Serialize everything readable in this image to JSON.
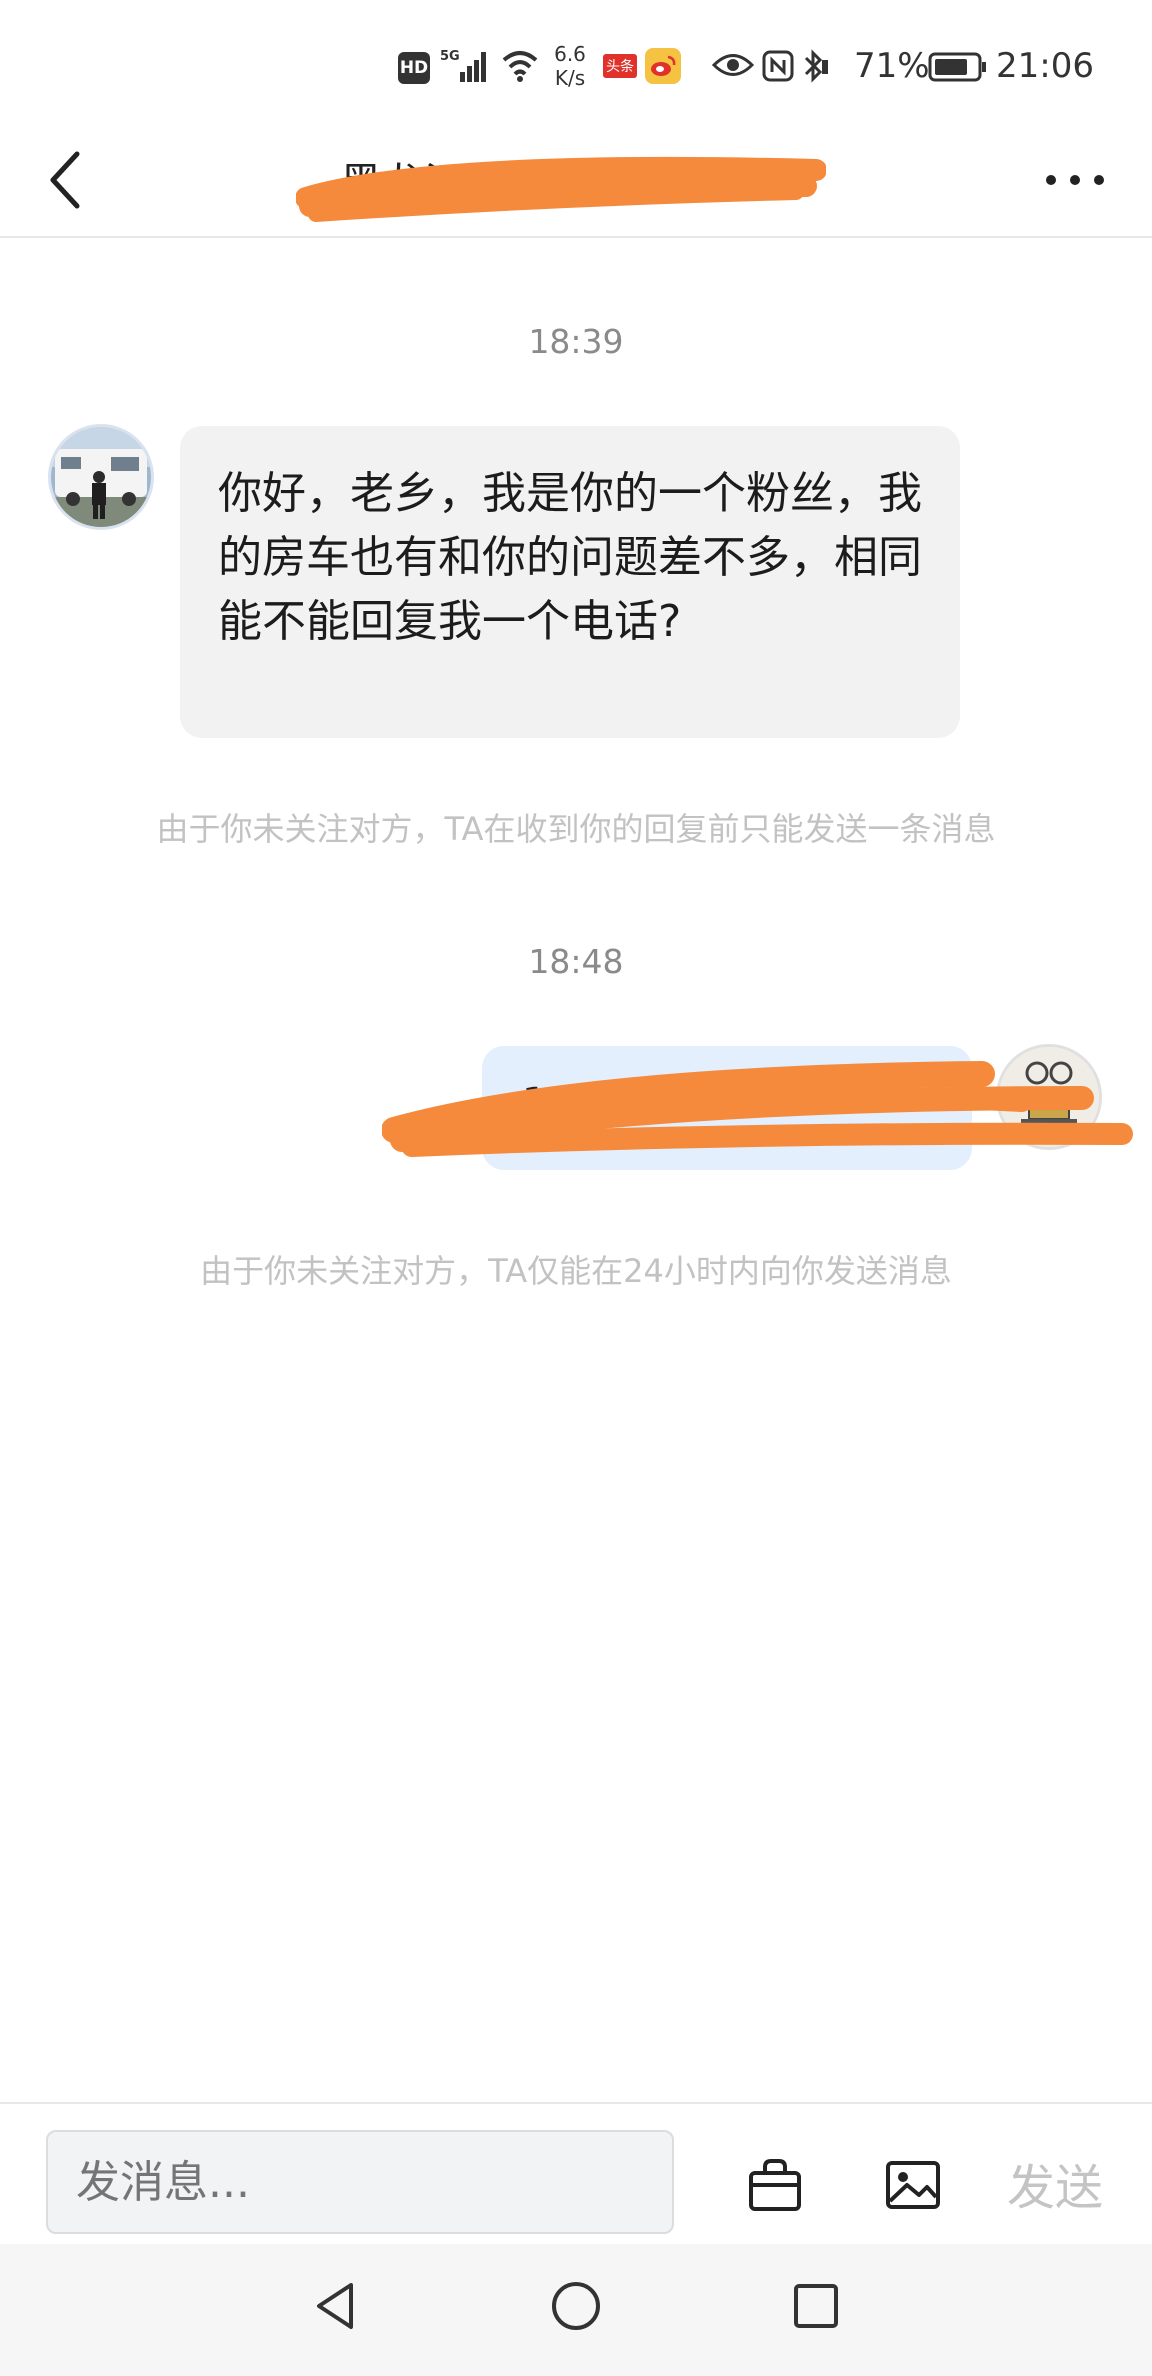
{
  "status_bar": {
    "hd": "HD",
    "network": "5G",
    "speed_value": "6.6",
    "speed_unit": "K/s",
    "toutiao_label": "头条",
    "battery_percent": "71%",
    "time": "21:06",
    "icons": [
      "hd-icon",
      "signal-icon",
      "wifi-icon",
      "toutiao-icon",
      "weibo-icon",
      "eye-icon",
      "nfc-icon",
      "bluetooth-icon",
      "battery-icon"
    ]
  },
  "header": {
    "title": "黑龙江房车自…",
    "back_icon": "chevron-left-icon",
    "more_icon": "more-horizontal-icon"
  },
  "messages": [
    {
      "timestamp": "18:39",
      "sender": "other",
      "text": "你好，老乡，我是你的一个粉丝，我的房车也有和你的问题差不多，相同能不能回复我一个电话?",
      "notice": "由于你未关注对方，TA在收到你的回复前只能发送一条消息"
    },
    {
      "timestamp": "18:48",
      "sender": "me",
      "text": "139",
      "notice": "由于你未关注对方，TA仅能在24小时内向你发送消息"
    }
  ],
  "input_bar": {
    "placeholder": "发消息...",
    "send_label": "发送",
    "bag_icon": "shopping-bag-icon",
    "image_icon": "image-icon"
  },
  "nav_bar": {
    "icons": [
      "nav-back-icon",
      "nav-home-icon",
      "nav-recent-icon"
    ]
  },
  "colors": {
    "bubble_other": "#f2f2f2",
    "bubble_me": "#e3effc",
    "redaction": "#f58a3c",
    "notice_text": "#c2c2c2",
    "timestamp_text": "#8a8a8a"
  }
}
